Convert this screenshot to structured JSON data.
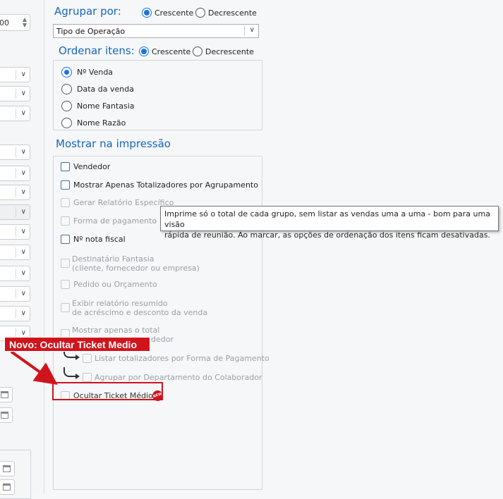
{
  "left_panel": {
    "number_value": "00",
    "calendar_icon": "calendar-icon"
  },
  "group_by": {
    "title": "Agrupar por:",
    "asc_label": "Crescente",
    "desc_label": "Decrescente",
    "selected": "asc",
    "select_value": "Tipo de Operação"
  },
  "order_items": {
    "title": "Ordenar itens:",
    "asc_label": "Crescente",
    "desc_label": "Decrescente",
    "selected": "asc",
    "options": [
      "Nº Venda",
      "Data da venda",
      "Nome Fantasia",
      "Nome Razão"
    ]
  },
  "show_print": {
    "title": "Mostrar na impressão",
    "vendedor": "Vendedor",
    "apenas_totalizadores": "Mostrar Apenas Totalizadores por Agrupamento",
    "gerar_relatorio": "Gerar Relatório Específico",
    "forma_pagamento": "Forma de pagamento",
    "nota_fiscal": "Nº nota fiscal",
    "destinatario_1": "Destinatário Fantasia",
    "destinatario_2": "(cliente, fornecedor ou empresa)",
    "pedido_orcamento": "Pedido ou Orçamento",
    "resumo_1": "Exibir relatório resumido",
    "resumo_2": "de acréscimo e desconto da venda",
    "apenas_total_1": "Mostrar apenas o total",
    "apenas_total_2": "dedor",
    "listar_totalizadores": "Listar totalizadores por Forma de Pagamento",
    "agrupar_departamento": "Agrupar por Departamento do Colaborador",
    "ocultar_ticket": "Ocultar Ticket Médio"
  },
  "tooltip": {
    "line1": "Imprime só o total de cada grupo, sem listar as vendas uma a uma - bom para uma visão",
    "line2": "rápida de reunião. Ao marcar, as opções de ordenação dos itens ficam desativadas."
  },
  "annotation": {
    "callout": "Novo: Ocultar Ticket Medio",
    "badge": "NEW",
    "color": "#d0141c"
  },
  "colors": {
    "accent": "#1a73e8",
    "title": "#1565c0"
  }
}
